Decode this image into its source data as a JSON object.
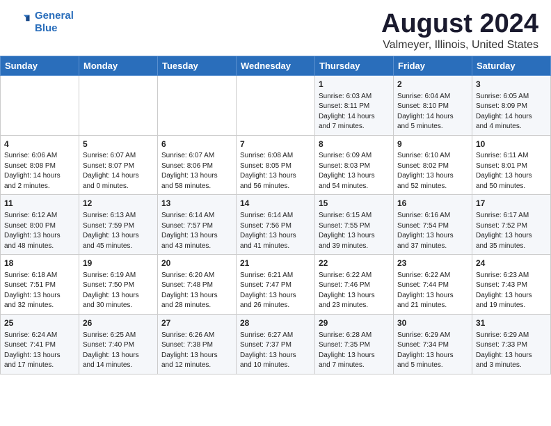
{
  "header": {
    "logo_line1": "General",
    "logo_line2": "Blue",
    "title": "August 2024",
    "subtitle": "Valmeyer, Illinois, United States"
  },
  "calendar": {
    "days_of_week": [
      "Sunday",
      "Monday",
      "Tuesday",
      "Wednesday",
      "Thursday",
      "Friday",
      "Saturday"
    ],
    "rows": [
      [
        {
          "day": "",
          "content": ""
        },
        {
          "day": "",
          "content": ""
        },
        {
          "day": "",
          "content": ""
        },
        {
          "day": "",
          "content": ""
        },
        {
          "day": "1",
          "content": "Sunrise: 6:03 AM\nSunset: 8:11 PM\nDaylight: 14 hours\nand 7 minutes."
        },
        {
          "day": "2",
          "content": "Sunrise: 6:04 AM\nSunset: 8:10 PM\nDaylight: 14 hours\nand 5 minutes."
        },
        {
          "day": "3",
          "content": "Sunrise: 6:05 AM\nSunset: 8:09 PM\nDaylight: 14 hours\nand 4 minutes."
        }
      ],
      [
        {
          "day": "4",
          "content": "Sunrise: 6:06 AM\nSunset: 8:08 PM\nDaylight: 14 hours\nand 2 minutes."
        },
        {
          "day": "5",
          "content": "Sunrise: 6:07 AM\nSunset: 8:07 PM\nDaylight: 14 hours\nand 0 minutes."
        },
        {
          "day": "6",
          "content": "Sunrise: 6:07 AM\nSunset: 8:06 PM\nDaylight: 13 hours\nand 58 minutes."
        },
        {
          "day": "7",
          "content": "Sunrise: 6:08 AM\nSunset: 8:05 PM\nDaylight: 13 hours\nand 56 minutes."
        },
        {
          "day": "8",
          "content": "Sunrise: 6:09 AM\nSunset: 8:03 PM\nDaylight: 13 hours\nand 54 minutes."
        },
        {
          "day": "9",
          "content": "Sunrise: 6:10 AM\nSunset: 8:02 PM\nDaylight: 13 hours\nand 52 minutes."
        },
        {
          "day": "10",
          "content": "Sunrise: 6:11 AM\nSunset: 8:01 PM\nDaylight: 13 hours\nand 50 minutes."
        }
      ],
      [
        {
          "day": "11",
          "content": "Sunrise: 6:12 AM\nSunset: 8:00 PM\nDaylight: 13 hours\nand 48 minutes."
        },
        {
          "day": "12",
          "content": "Sunrise: 6:13 AM\nSunset: 7:59 PM\nDaylight: 13 hours\nand 45 minutes."
        },
        {
          "day": "13",
          "content": "Sunrise: 6:14 AM\nSunset: 7:57 PM\nDaylight: 13 hours\nand 43 minutes."
        },
        {
          "day": "14",
          "content": "Sunrise: 6:14 AM\nSunset: 7:56 PM\nDaylight: 13 hours\nand 41 minutes."
        },
        {
          "day": "15",
          "content": "Sunrise: 6:15 AM\nSunset: 7:55 PM\nDaylight: 13 hours\nand 39 minutes."
        },
        {
          "day": "16",
          "content": "Sunrise: 6:16 AM\nSunset: 7:54 PM\nDaylight: 13 hours\nand 37 minutes."
        },
        {
          "day": "17",
          "content": "Sunrise: 6:17 AM\nSunset: 7:52 PM\nDaylight: 13 hours\nand 35 minutes."
        }
      ],
      [
        {
          "day": "18",
          "content": "Sunrise: 6:18 AM\nSunset: 7:51 PM\nDaylight: 13 hours\nand 32 minutes."
        },
        {
          "day": "19",
          "content": "Sunrise: 6:19 AM\nSunset: 7:50 PM\nDaylight: 13 hours\nand 30 minutes."
        },
        {
          "day": "20",
          "content": "Sunrise: 6:20 AM\nSunset: 7:48 PM\nDaylight: 13 hours\nand 28 minutes."
        },
        {
          "day": "21",
          "content": "Sunrise: 6:21 AM\nSunset: 7:47 PM\nDaylight: 13 hours\nand 26 minutes."
        },
        {
          "day": "22",
          "content": "Sunrise: 6:22 AM\nSunset: 7:46 PM\nDaylight: 13 hours\nand 23 minutes."
        },
        {
          "day": "23",
          "content": "Sunrise: 6:22 AM\nSunset: 7:44 PM\nDaylight: 13 hours\nand 21 minutes."
        },
        {
          "day": "24",
          "content": "Sunrise: 6:23 AM\nSunset: 7:43 PM\nDaylight: 13 hours\nand 19 minutes."
        }
      ],
      [
        {
          "day": "25",
          "content": "Sunrise: 6:24 AM\nSunset: 7:41 PM\nDaylight: 13 hours\nand 17 minutes."
        },
        {
          "day": "26",
          "content": "Sunrise: 6:25 AM\nSunset: 7:40 PM\nDaylight: 13 hours\nand 14 minutes."
        },
        {
          "day": "27",
          "content": "Sunrise: 6:26 AM\nSunset: 7:38 PM\nDaylight: 13 hours\nand 12 minutes."
        },
        {
          "day": "28",
          "content": "Sunrise: 6:27 AM\nSunset: 7:37 PM\nDaylight: 13 hours\nand 10 minutes."
        },
        {
          "day": "29",
          "content": "Sunrise: 6:28 AM\nSunset: 7:35 PM\nDaylight: 13 hours\nand 7 minutes."
        },
        {
          "day": "30",
          "content": "Sunrise: 6:29 AM\nSunset: 7:34 PM\nDaylight: 13 hours\nand 5 minutes."
        },
        {
          "day": "31",
          "content": "Sunrise: 6:29 AM\nSunset: 7:33 PM\nDaylight: 13 hours\nand 3 minutes."
        }
      ]
    ]
  }
}
